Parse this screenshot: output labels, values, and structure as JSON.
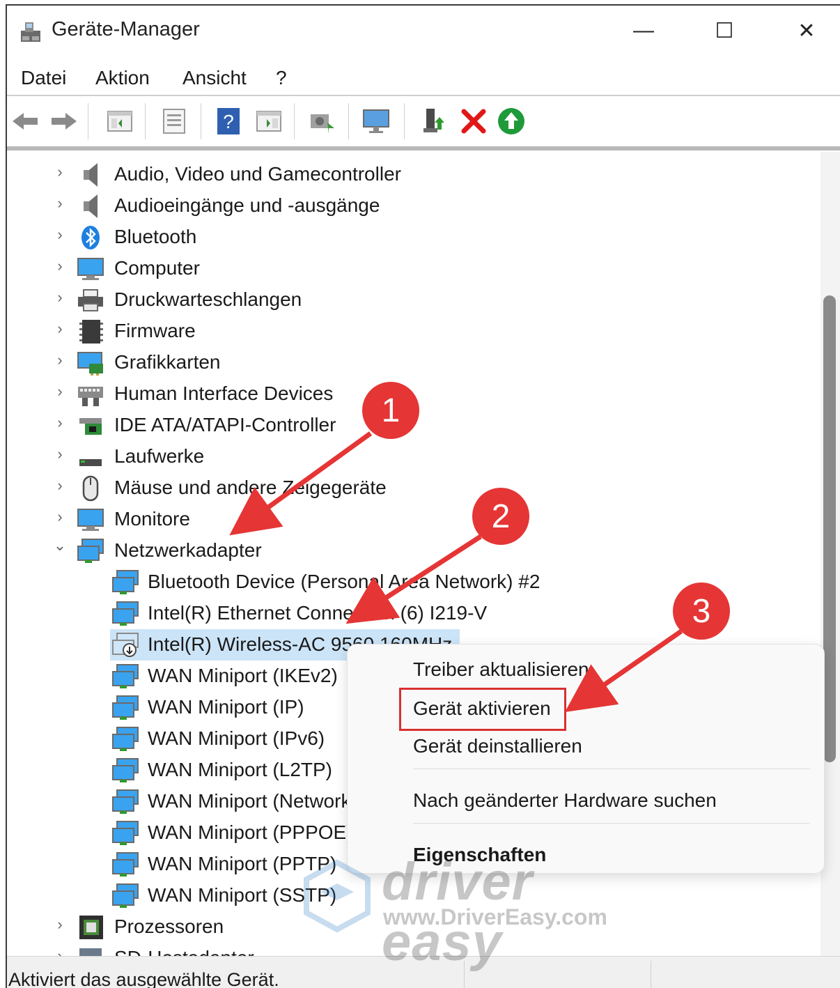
{
  "window": {
    "title": "Geräte-Manager",
    "controls": {
      "minimize": "—",
      "maximize": "☐",
      "close": "✕"
    }
  },
  "menu": [
    "Datei",
    "Aktion",
    "Ansicht",
    "?"
  ],
  "toolbar": {
    "buttons": [
      "back-arrow-icon",
      "forward-arrow-icon",
      "show-hide-console-tree-icon",
      "properties-icon",
      "help-icon",
      "action-pane-icon",
      "scan-hardware-icon",
      "monitor-icon",
      "update-driver-icon",
      "uninstall-device-icon",
      "enable-device-icon"
    ]
  },
  "tree": {
    "items": [
      {
        "label": "Audio, Video und Gamecontroller",
        "chevron": "›",
        "icon": "speaker-icon"
      },
      {
        "label": "Audioeingänge und -ausgänge",
        "chevron": "›",
        "icon": "speaker-icon"
      },
      {
        "label": "Bluetooth",
        "chevron": "›",
        "icon": "bluetooth-icon"
      },
      {
        "label": "Computer",
        "chevron": "›",
        "icon": "computer-icon"
      },
      {
        "label": "Druckwarteschlangen",
        "chevron": "›",
        "icon": "printer-icon"
      },
      {
        "label": "Firmware",
        "chevron": "›",
        "icon": "firmware-chip-icon"
      },
      {
        "label": "Grafikkarten",
        "chevron": "›",
        "icon": "display-adapter-icon"
      },
      {
        "label": "Human Interface Devices",
        "chevron": "›",
        "icon": "keyboard-hid-icon"
      },
      {
        "label": "IDE ATA/ATAPI-Controller",
        "chevron": "›",
        "icon": "ide-controller-icon"
      },
      {
        "label": "Laufwerke",
        "chevron": "›",
        "icon": "drive-icon"
      },
      {
        "label": "Mäuse und andere Zeigegeräte",
        "chevron": "›",
        "icon": "mouse-icon"
      },
      {
        "label": "Monitore",
        "chevron": "›",
        "icon": "monitor-icon"
      },
      {
        "label": "Netzwerkadapter",
        "chevron": "⌄",
        "icon": "network-adapter-icon"
      }
    ],
    "network_children": [
      {
        "label": "Bluetooth Device (Personal Area Network) #2"
      },
      {
        "label": "Intel(R) Ethernet Connection (6) I219-V"
      },
      {
        "label": "Intel(R) Wireless-AC 9560 160MHz",
        "selected": true,
        "disabled": true
      },
      {
        "label": "WAN Miniport (IKEv2)"
      },
      {
        "label": "WAN Miniport (IP)"
      },
      {
        "label": "WAN Miniport (IPv6)"
      },
      {
        "label": "WAN Miniport (L2TP)"
      },
      {
        "label": "WAN Miniport (Network Monitor)"
      },
      {
        "label": "WAN Miniport (PPPOE)"
      },
      {
        "label": "WAN Miniport (PPTP)"
      },
      {
        "label": "WAN Miniport (SSTP)"
      }
    ],
    "after": [
      {
        "label": "Prozessoren",
        "chevron": "›",
        "icon": "processor-icon"
      },
      {
        "label": "SD-Hostadapter",
        "chevron": "›",
        "icon": "sd-host-icon"
      }
    ]
  },
  "context_menu": {
    "items": [
      {
        "label": "Treiber aktualisieren"
      },
      {
        "label": "Gerät aktivieren",
        "highlighted": true
      },
      {
        "label": "Gerät deinstallieren"
      },
      {
        "label": "Nach geänderter Hardware suchen"
      },
      {
        "label": "Eigenschaften",
        "bold": true
      }
    ]
  },
  "annotations": {
    "badges": [
      "1",
      "2",
      "3"
    ],
    "color": "#e53535"
  },
  "watermark": {
    "brand": "driver easy",
    "url": "www.DriverEasy.com"
  },
  "status": {
    "text": "Aktiviert das ausgewählte Gerät."
  },
  "colors": {
    "selection": "#cce4f7",
    "highlight_border": "#d93030",
    "accent": "#e53535"
  }
}
